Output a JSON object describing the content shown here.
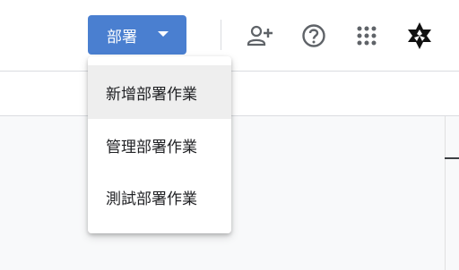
{
  "header": {
    "deploy_button": {
      "label": "部署",
      "icon": "caret-down-icon"
    },
    "icons": [
      {
        "name": "add-person-icon"
      },
      {
        "name": "help-icon"
      },
      {
        "name": "apps-grid-icon"
      },
      {
        "name": "account-logo-icon"
      }
    ]
  },
  "dropdown": {
    "items": [
      {
        "label": "新增部署作業",
        "highlighted": true
      },
      {
        "label": "管理部署作業",
        "highlighted": false
      },
      {
        "label": "測試部署作業",
        "highlighted": false
      }
    ]
  },
  "colors": {
    "accent": "#4a7fd0",
    "hover": "#eeeeee",
    "text": "#202124",
    "icon": "#5f6368"
  }
}
